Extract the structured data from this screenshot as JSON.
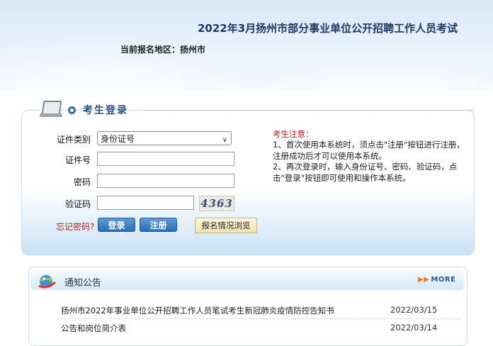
{
  "header": {
    "title": "2022年3月扬州市部分事业单位公开招聘工作人员考试",
    "region_label": "当前报名地区：",
    "region_value": "扬州市"
  },
  "login": {
    "title": "考生登录",
    "id_type_label": "证件类别",
    "id_type_selected": "身份证号",
    "id_number_label": "证件号",
    "password_label": "密码",
    "captcha_label": "验证码",
    "captcha_code": "4363",
    "forgot_password": "忘记密码?",
    "login_button": "登录",
    "register_button": "注册",
    "browse_button": "报名情况浏览"
  },
  "notice": {
    "title": "考生注意：",
    "text": "1、首次使用本系统时，须点击\"注册\"按钮进行注册，注册成功后才可以使用本系统。\n2、再次登录时，输入身份证号、密码、验证码，点击\"登录\"按钮即可使用和操作本系统。"
  },
  "announcements": {
    "title": "通知公告",
    "more_label": "MORE",
    "items": [
      {
        "text": "扬州市2022年事业单位公开招聘工作人员笔试考生新冠肺炎疫情防控告知书",
        "date": "2022/03/15"
      },
      {
        "text": "公告和岗位简介表",
        "date": "2022/03/14"
      }
    ]
  }
}
